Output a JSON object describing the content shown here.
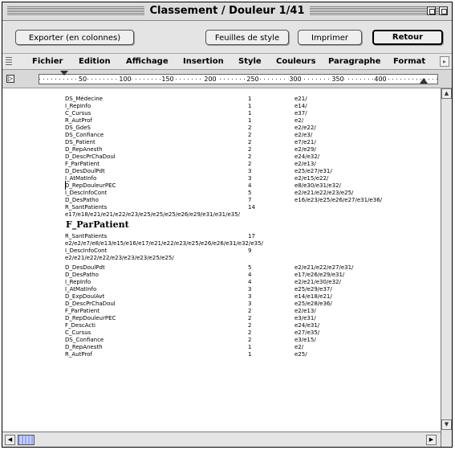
{
  "window": {
    "title": "Classement / Douleur 1/41"
  },
  "toolbar": {
    "export_label": "Exporter (en colonnes)",
    "styles_label": "Feuilles de style",
    "print_label": "Imprimer",
    "back_label": "Retour"
  },
  "menu": {
    "items": [
      {
        "label": "Fichier"
      },
      {
        "label": "Edition"
      },
      {
        "label": "Affichage"
      },
      {
        "label": "Insertion"
      },
      {
        "label": "Style"
      },
      {
        "label": "Couleurs"
      },
      {
        "label": "Paragraphe"
      },
      {
        "label": "Format"
      }
    ]
  },
  "ruler": {
    "ticks": [
      "50",
      "100",
      "150",
      "200",
      "250",
      "300",
      "350",
      "400"
    ]
  },
  "content": {
    "block1": [
      {
        "name": "DS_Médecine",
        "count": "1",
        "refs": "e21/"
      },
      {
        "name": "I_RepInfo",
        "count": "1",
        "refs": "e14/"
      },
      {
        "name": "C_Cursus",
        "count": "1",
        "refs": "e37/"
      },
      {
        "name": "R_AutProf",
        "count": "1",
        "refs": "e2/"
      },
      {
        "name": "DS_GdeS",
        "count": "2",
        "refs": "e2/e22/"
      },
      {
        "name": "DS_Confiance",
        "count": "2",
        "refs": "e2/e3/"
      },
      {
        "name": "DS_Patient",
        "count": "2",
        "refs": "e7/e21/"
      },
      {
        "name": "D_RepAnesth",
        "count": "2",
        "refs": "e2/e29/"
      },
      {
        "name": "D_DescPrChaDoul",
        "count": "2",
        "refs": "e24/e32/"
      },
      {
        "name": "F_ParPatient",
        "count": "2",
        "refs": "e2/e13/"
      },
      {
        "name": "D_DesDoulPdt",
        "count": "3",
        "refs": "e25/e27/e31/"
      },
      {
        "name": "I_AtMatInfo",
        "count": "3",
        "refs": "e2/e15/e22/"
      },
      {
        "name": "D_RepDouleurPEC",
        "count": "4",
        "refs": "e8/e30/e31/e32/"
      },
      {
        "name": "I_DescInfoCont",
        "count": "5",
        "refs": "e2/e21/e22/e23/e25/"
      },
      {
        "name": "D_DesPatho",
        "count": "7",
        "refs": "e16/e23/e25/e26/e27/e31/e36/"
      }
    ],
    "sant1": {
      "name": "R_SantPatients",
      "count": "14",
      "refs": "e17/e18/e21/e21/e22/e23/e25/e25/e25/e26/e29/e31/e31/e35/"
    },
    "section_title": "F_ParPatient",
    "sant2": {
      "name": "R_SantPatients",
      "count": "17",
      "refs": "e2/e2/e7/e8/e13/e15/e16/e17/e21/e22/e23/e25/e26/e26/e31/e32/e35/"
    },
    "info2": {
      "name": "I_DescInfoCont",
      "count": "9",
      "refs": "e2/e21/e22/e22/e23/e23/e23/e25/e25/"
    },
    "block2": [
      {
        "name": "D_DesDoulPdt",
        "count": "5",
        "refs": "e2/e21/e22/e27/e31/"
      },
      {
        "name": "D_DesPatho",
        "count": "4",
        "refs": "e17/e26/e29/e31/"
      },
      {
        "name": "I_RepInfo",
        "count": "4",
        "refs": "e2/e21/e30/e32/"
      },
      {
        "name": "I_AtMatInfo",
        "count": "3",
        "refs": "e25/e29/e37/"
      },
      {
        "name": "D_ExpDoulAvt",
        "count": "3",
        "refs": "e14/e18/e21/"
      },
      {
        "name": "D_DescPrChaDoul",
        "count": "3",
        "refs": "e25/e28/e36/"
      },
      {
        "name": "F_ParPatient",
        "count": "2",
        "refs": "e2/e13/"
      },
      {
        "name": "D_RepDouleurPEC",
        "count": "2",
        "refs": "e3/e31/"
      },
      {
        "name": "F_DescActi",
        "count": "2",
        "refs": "e24/e31/"
      },
      {
        "name": "C_Cursus",
        "count": "2",
        "refs": "e27/e35/"
      },
      {
        "name": "DS_Confiance",
        "count": "2",
        "refs": "e3/e15/"
      },
      {
        "name": "D_RepAnesth",
        "count": "1",
        "refs": "e2/"
      },
      {
        "name": "R_AutProf",
        "count": "1",
        "refs": "e25/"
      }
    ]
  }
}
